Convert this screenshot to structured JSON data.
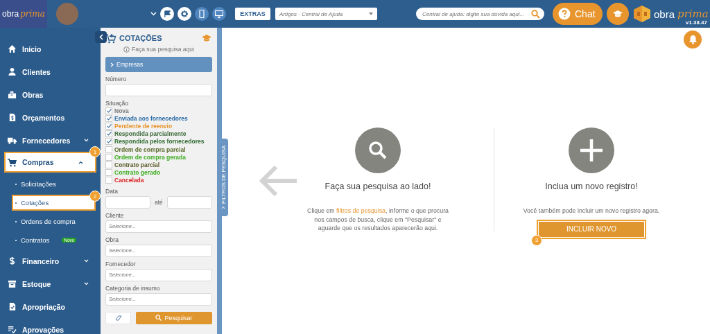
{
  "topbar": {
    "logo": {
      "word": "obra",
      "script": "prima"
    },
    "extras_button": "EXTRAS",
    "help_select": {
      "placeholder": "Artigos - Central de Ajuda"
    },
    "help_search": {
      "placeholder": "Central de ajuda: digite sua dúvida aqui..."
    },
    "chat_button": "Chat",
    "brand": {
      "word": "obra",
      "script": "prima"
    },
    "version": "v1.38.47"
  },
  "sidebar": {
    "items": [
      {
        "label": "Início"
      },
      {
        "label": "Clientes"
      },
      {
        "label": "Obras"
      },
      {
        "label": "Orçamentos"
      },
      {
        "label": "Fornecedores",
        "expanded": false
      },
      {
        "label": "Compras",
        "expanded": true,
        "callout": "1",
        "children": [
          {
            "label": "Solicitações",
            "selected": false
          },
          {
            "label": "Cotações",
            "selected": true,
            "callout": "2"
          },
          {
            "label": "Ordens de compra",
            "selected": false
          },
          {
            "label": "Contratos",
            "selected": false,
            "badge": "Novo"
          }
        ]
      },
      {
        "label": "Financeiro",
        "expanded": false
      },
      {
        "label": "Estoque",
        "expanded": false
      },
      {
        "label": "Apropriação"
      },
      {
        "label": "Aprovações"
      }
    ]
  },
  "filters": {
    "title": "COTAÇÕES",
    "hint": "Faça sua pesquisa aqui",
    "section": "Empresas",
    "numero_label": "Número",
    "situacao_label": "Situação",
    "statuses": [
      {
        "label": "Nova",
        "checked": true,
        "color": "#7a7a7a"
      },
      {
        "label": "Enviada aos fornecedores",
        "checked": true,
        "color": "#2a6aa6"
      },
      {
        "label": "Pendente de reenvio",
        "checked": true,
        "color": "#e8952e"
      },
      {
        "label": "Respondida parcialmente",
        "checked": true,
        "color": "#3d6b3d"
      },
      {
        "label": "Respondida pelos fornecedores",
        "checked": true,
        "color": "#2f6b2f"
      },
      {
        "label": "Ordem de compra parcial",
        "checked": false,
        "color": "#5a6a2a"
      },
      {
        "label": "Ordem de compra gerada",
        "checked": false,
        "color": "#3fae22"
      },
      {
        "label": "Contrato parcial",
        "checked": false,
        "color": "#5a5a28"
      },
      {
        "label": "Contrato gerado",
        "checked": false,
        "color": "#3fae22"
      },
      {
        "label": "Cancelada",
        "checked": false,
        "color": "#dd2222"
      }
    ],
    "data_label": "Data",
    "date_separator": "até",
    "selects": [
      {
        "label": "Cliente",
        "placeholder": "Selecione..."
      },
      {
        "label": "Obra",
        "placeholder": "Selecione..."
      },
      {
        "label": "Fornecedor",
        "placeholder": "Selecione..."
      },
      {
        "label": "Categoria de insumo",
        "placeholder": "Selecione..."
      }
    ],
    "search_button": "Pesquisar",
    "side_tab": "FILTROS DE PESQUISA"
  },
  "main": {
    "search_panel": {
      "title": "Faça sua pesquisa ao lado!",
      "text_before": "Clique em ",
      "link": "filtros de pesquisa",
      "text_after": ", informe o que procura nos campos de busca, clique em \"Pesquisar\" e aguarde que os resultados aparecerão aqui."
    },
    "new_panel": {
      "title": "Inclua um novo registro!",
      "text": "Você também pode incluir um novo registro agora.",
      "button": "INCLUIR NOVO",
      "callout": "3"
    }
  }
}
